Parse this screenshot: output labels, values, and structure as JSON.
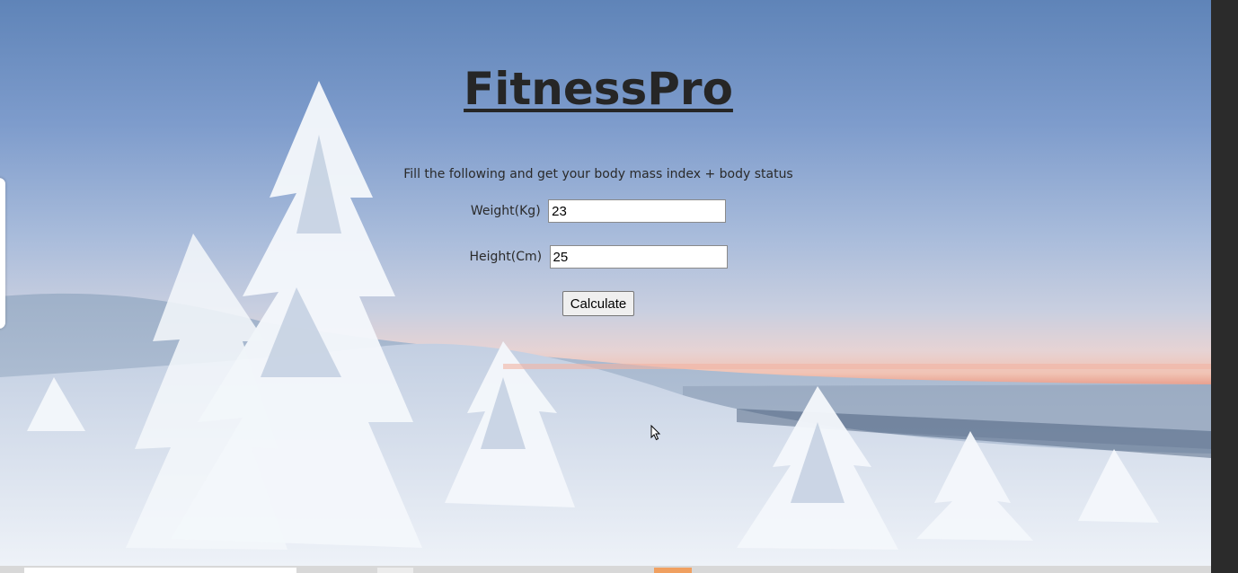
{
  "app": {
    "title": "FitnessPro",
    "subtitle": "Fill the following and get your body mass index + body status"
  },
  "form": {
    "weight_label": "Weight(Kg)",
    "weight_value": "23",
    "height_label": "Height(Cm)",
    "height_value": "25",
    "calculate_label": "Calculate"
  },
  "theme": {
    "title_color": "#262626",
    "sky_top": "#5f84b8",
    "sunset": "#e89f8e",
    "snow": "#e8eef6"
  },
  "icons": {
    "cursor": "mouse-pointer-icon"
  }
}
